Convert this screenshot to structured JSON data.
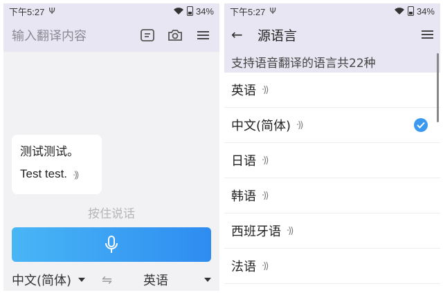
{
  "status": {
    "time": "下午5:27",
    "signal_glyph": "Ψ",
    "battery": "34%"
  },
  "left": {
    "input_placeholder": "输入翻译内容",
    "toolbar_icons": [
      "keyboard-icon",
      "camera-icon",
      "menu-icon"
    ],
    "bubble": {
      "source_text": "测试测试。",
      "translated_text": "Test test."
    },
    "hold_hint": "按住说话",
    "source_lang": "中文(简体)",
    "swap_symbol": "⇋",
    "target_lang": "英语",
    "accent_gradient": [
      "#49b6f6",
      "#2e8cf0"
    ]
  },
  "right": {
    "title": "源语言",
    "subheader": "支持语音翻译的语言共22种",
    "languages": [
      {
        "label": "英语",
        "selected": false
      },
      {
        "label": "中文(简体)",
        "selected": true
      },
      {
        "label": "日语",
        "selected": false
      },
      {
        "label": "韩语",
        "selected": false
      },
      {
        "label": "西班牙语",
        "selected": false
      },
      {
        "label": "法语",
        "selected": false
      }
    ],
    "check_color": "#3b9af0"
  }
}
